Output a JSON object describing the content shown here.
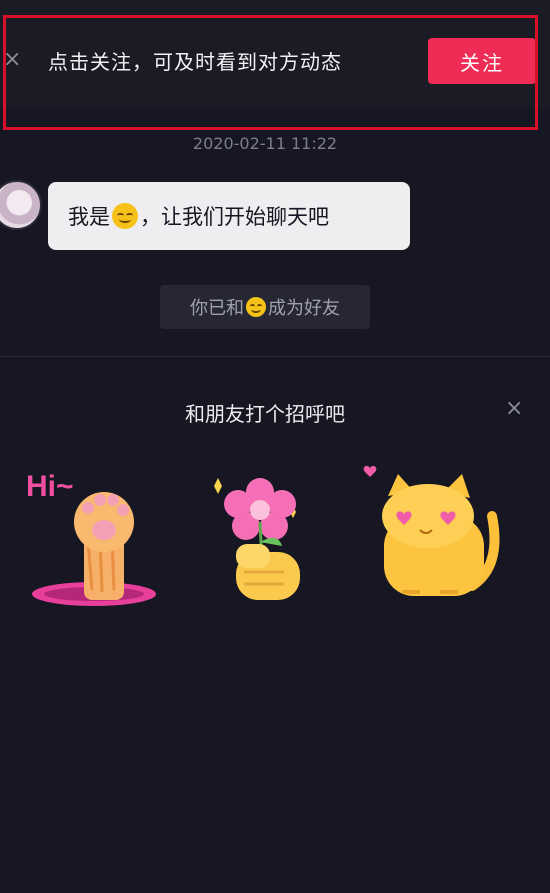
{
  "banner": {
    "close_glyph": "×",
    "text": "点击关注，可及时看到对方动态",
    "follow_label": "关注"
  },
  "chat": {
    "timestamp": "2020-02-11 11:22",
    "message_before": "我是",
    "message_after": "，让我们开始聊天吧",
    "friend_before": "你已和",
    "friend_after": "成为好友"
  },
  "greeting": {
    "title": "和朋友打个招呼吧",
    "close_glyph": "×",
    "stickers": [
      {
        "name": "paw-wave",
        "caption": "Hi~"
      },
      {
        "name": "flower-hand",
        "caption": ""
      },
      {
        "name": "heart-eyes-cat",
        "caption": ""
      }
    ]
  },
  "colors": {
    "background": "#161722",
    "accent": "#ef2c55",
    "highlight_border": "#d8102a"
  }
}
